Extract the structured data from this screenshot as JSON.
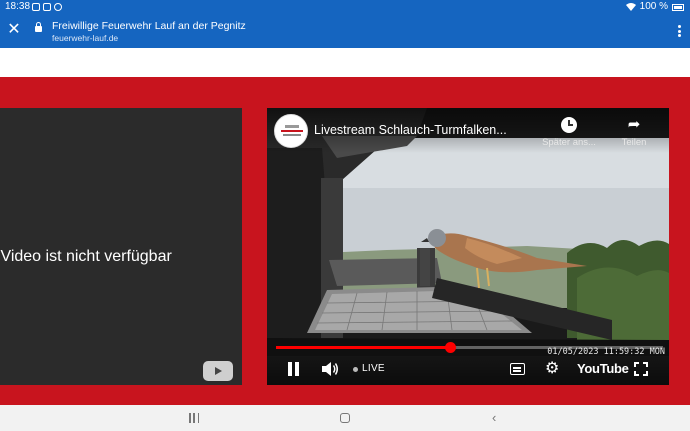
{
  "status_bar": {
    "time": "18:38",
    "battery_percent": "100 %"
  },
  "custom_tab": {
    "title": "Freiwillige Feuerwehr Lauf an der Pegnitz",
    "url": "feuerwehr-lauf.de"
  },
  "left_video": {
    "message": "s Video ist nicht verfügbar"
  },
  "right_video": {
    "title": "Livestream Schlauch-Turmfalken...",
    "watch_later_label": "Später ans...",
    "share_label": "Teilen",
    "timestamp": "01/05/2023 11:59:32 MON",
    "live_label": "LIVE",
    "brand_label": "YouTube",
    "progress": 0.45
  },
  "icons": {
    "close": "close-icon",
    "lock": "lock-icon",
    "menu": "more-vert-icon",
    "clock": "clock-icon",
    "share": "share-icon",
    "pause": "pause-icon",
    "volume": "volume-icon",
    "subtitles": "subtitles-icon",
    "settings": "gear-icon",
    "fullscreen": "fullscreen-icon"
  },
  "colors": {
    "browser_bar": "#1565c0",
    "page_red": "#c8141e",
    "progress_red": "#ff0000"
  }
}
